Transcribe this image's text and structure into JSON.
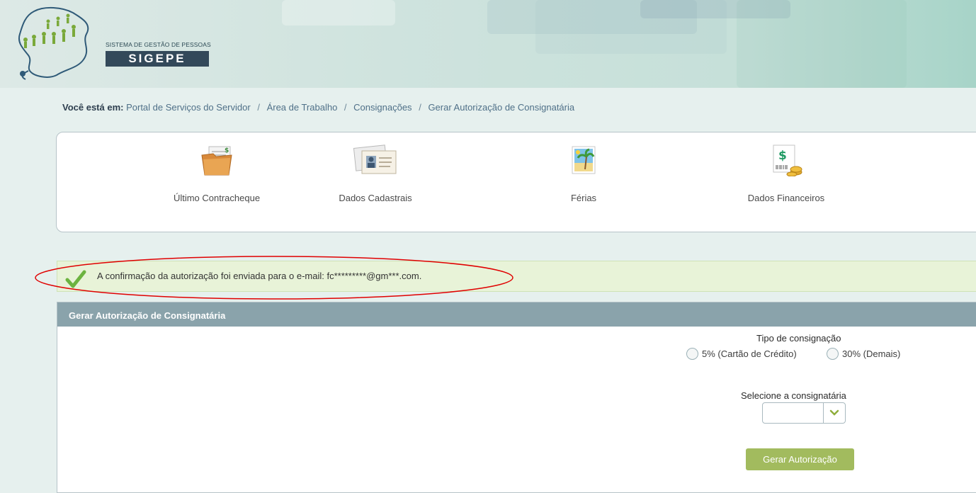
{
  "header": {
    "logo_subtitle": "SISTEMA DE GESTÃO DE PESSOAS",
    "logo_title": "SIGEPE"
  },
  "breadcrumb": {
    "lead": "Você está em:",
    "items": [
      "Portal de Serviços do Servidor",
      "Área de Trabalho",
      "Consignações",
      "Gerar Autorização de Consignatária"
    ],
    "separator": "/"
  },
  "shortcuts": [
    {
      "label": "Último Contracheque",
      "icon": "folder-document-icon"
    },
    {
      "label": "Dados Cadastrais",
      "icon": "id-card-icon"
    },
    {
      "label": "Férias",
      "icon": "beach-palm-icon"
    },
    {
      "label": "Dados Financeiros",
      "icon": "money-coins-icon"
    }
  ],
  "alert": {
    "message": "A confirmação da autorização foi enviada para o e-mail: fc*********@gm***.com.",
    "icon": "checkmark-icon",
    "highlight_color": "#e00000"
  },
  "form": {
    "title": "Gerar Autorização de Consignatária",
    "tipo_label": "Tipo de consignação",
    "options": [
      "5% (Cartão de Crédito)",
      "30% (Demais)"
    ],
    "select_label": "Selecione a consignatária",
    "select_value": "",
    "submit_label": "Gerar Autorização"
  },
  "colors": {
    "accent_green": "#a2bb5e",
    "panel_header": "#8aa3ab",
    "alert_bg": "#e8f3d8"
  }
}
